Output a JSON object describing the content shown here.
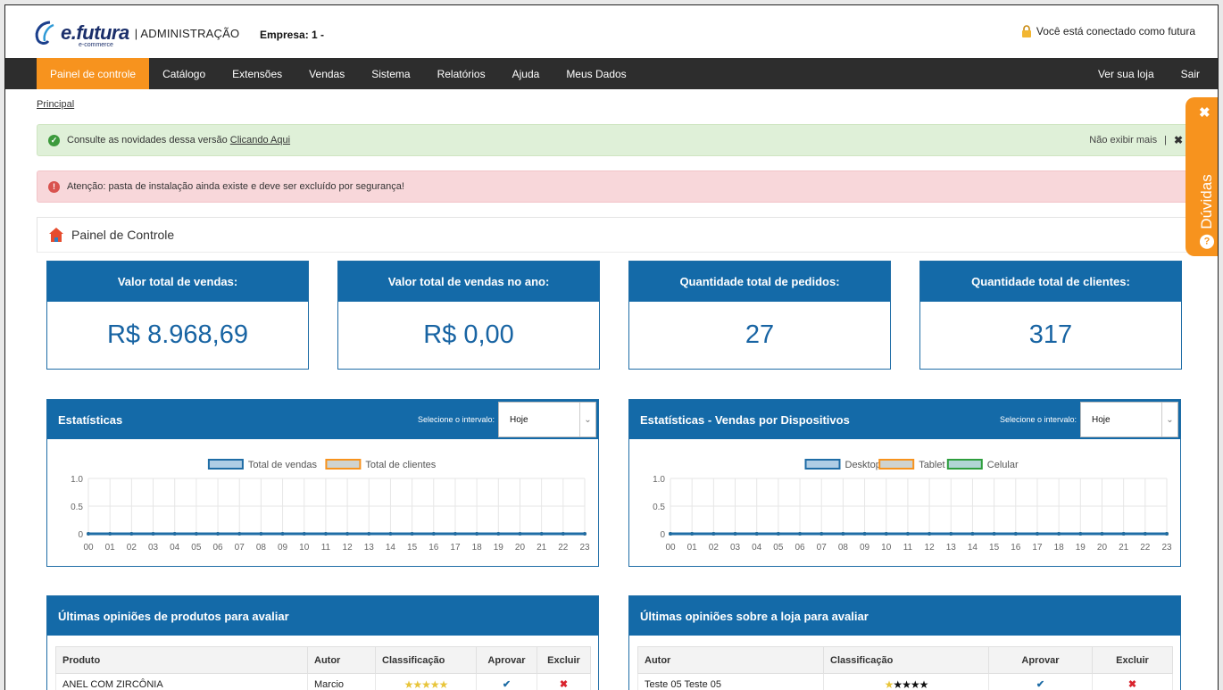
{
  "header": {
    "logo_main": "e.futura",
    "logo_sub": "e-commerce",
    "logo_admin": "| ADMINISTRAÇÃO",
    "empresa": "Empresa: 1 -",
    "connected": "Você está conectado como futura"
  },
  "nav": {
    "items": [
      "Painel de controle",
      "Catálogo",
      "Extensões",
      "Vendas",
      "Sistema",
      "Relatórios",
      "Ajuda",
      "Meus Dados"
    ],
    "right_items": [
      "Ver sua loja",
      "Sair"
    ]
  },
  "breadcrumb": "Principal",
  "alerts": {
    "success_text": "Consulte as novidades dessa versão",
    "success_link": "Clicando Aqui",
    "dismiss": "Não exibir mais",
    "separator": "|",
    "danger_text": "Atenção: pasta de instalação ainda existe e deve ser excluído por segurança!"
  },
  "panel_title": "Painel de Controle",
  "duvidas": "Dúvidas",
  "cards": [
    {
      "label": "Valor total de vendas:",
      "value": "R$ 8.968,69"
    },
    {
      "label": "Valor total de vendas no ano:",
      "value": "R$ 0,00"
    },
    {
      "label": "Quantidade total de pedidos:",
      "value": "27"
    },
    {
      "label": "Quantidade total de clientes:",
      "value": "317"
    }
  ],
  "stats_panels": [
    {
      "title": "Estatísticas",
      "select_label": "Selecione o intervalo:",
      "select_value": "Hoje"
    },
    {
      "title": "Estatísticas - Vendas por Dispositivos",
      "select_label": "Selecione o intervalo:",
      "select_value": "Hoje"
    }
  ],
  "chart_data": [
    {
      "type": "line",
      "x": [
        "00",
        "01",
        "02",
        "03",
        "04",
        "05",
        "06",
        "07",
        "08",
        "09",
        "10",
        "11",
        "12",
        "13",
        "14",
        "15",
        "16",
        "17",
        "18",
        "19",
        "20",
        "21",
        "22",
        "23"
      ],
      "ylim": [
        0,
        1.0
      ],
      "yticks": [
        "1.0",
        "0.5",
        "0"
      ],
      "grid": true,
      "legend_position": "top",
      "series": [
        {
          "name": "Total de vendas",
          "color": "#1f6da6",
          "values": [
            0,
            0,
            0,
            0,
            0,
            0,
            0,
            0,
            0,
            0,
            0,
            0,
            0,
            0,
            0,
            0,
            0,
            0,
            0,
            0,
            0,
            0,
            0,
            0
          ]
        },
        {
          "name": "Total de clientes",
          "color": "#f7931e",
          "values": [
            0,
            0,
            0,
            0,
            0,
            0,
            0,
            0,
            0,
            0,
            0,
            0,
            0,
            0,
            0,
            0,
            0,
            0,
            0,
            0,
            0,
            0,
            0,
            0
          ]
        }
      ]
    },
    {
      "type": "line",
      "x": [
        "00",
        "01",
        "02",
        "03",
        "04",
        "05",
        "06",
        "07",
        "08",
        "09",
        "10",
        "11",
        "12",
        "13",
        "14",
        "15",
        "16",
        "17",
        "18",
        "19",
        "20",
        "21",
        "22",
        "23"
      ],
      "ylim": [
        0,
        1.0
      ],
      "yticks": [
        "1.0",
        "0.5",
        "0"
      ],
      "grid": true,
      "legend_position": "top",
      "series": [
        {
          "name": "Desktop",
          "color": "#1f6da6",
          "values": [
            0,
            0,
            0,
            0,
            0,
            0,
            0,
            0,
            0,
            0,
            0,
            0,
            0,
            0,
            0,
            0,
            0,
            0,
            0,
            0,
            0,
            0,
            0,
            0
          ]
        },
        {
          "name": "Tablet",
          "color": "#f7931e",
          "values": [
            0,
            0,
            0,
            0,
            0,
            0,
            0,
            0,
            0,
            0,
            0,
            0,
            0,
            0,
            0,
            0,
            0,
            0,
            0,
            0,
            0,
            0,
            0,
            0
          ]
        },
        {
          "name": "Celular",
          "color": "#2e9e3e",
          "values": [
            0,
            0,
            0,
            0,
            0,
            0,
            0,
            0,
            0,
            0,
            0,
            0,
            0,
            0,
            0,
            0,
            0,
            0,
            0,
            0,
            0,
            0,
            0,
            0
          ]
        }
      ]
    }
  ],
  "reviews_products": {
    "title": "Últimas opiniões de produtos para avaliar",
    "columns": [
      "Produto",
      "Autor",
      "Classificação",
      "Aprovar",
      "Excluir"
    ],
    "rows": [
      {
        "produto": "ANEL COM ZIRCÔNIA",
        "autor": "Marcio",
        "stars_filled": "★★★★★",
        "stars_empty": ""
      }
    ]
  },
  "reviews_store": {
    "title": "Últimas opiniões sobre a loja para avaliar",
    "columns": [
      "Autor",
      "Classificação",
      "Aprovar",
      "Excluir"
    ],
    "rows": [
      {
        "autor": "Teste 05 Teste 05",
        "stars_filled": "★",
        "stars_empty": "★★★★"
      }
    ]
  },
  "colors": {
    "accent": "#f7931e",
    "primary": "#146aa8",
    "nav_bg": "#2d2d2d",
    "star_filled": "#e8c53a",
    "star_empty": "#111111"
  }
}
